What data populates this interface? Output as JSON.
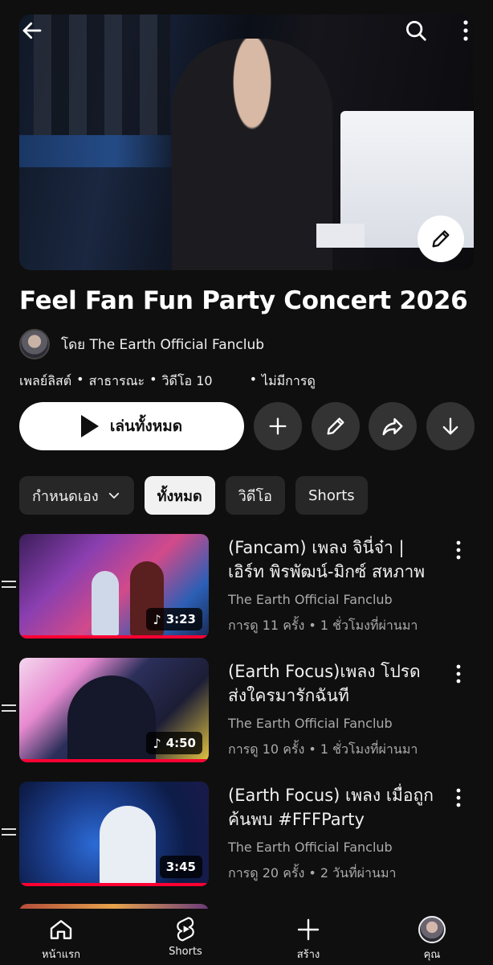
{
  "playlist": {
    "title": "Feel Fan Fun Party Concert 2026",
    "owner": "โดย The Earth Official Fanclub",
    "meta": {
      "type": "เพลย์ลิสต์",
      "visibility": "สาธารณะ",
      "video_count": "วิดีโอ 10",
      "views": "ไม่มีการดู"
    }
  },
  "actions": {
    "play_all": "เล่นทั้งหมด",
    "add_icon": "plus-icon",
    "edit_icon": "pencil-icon",
    "share_icon": "share-icon",
    "download_icon": "download-icon"
  },
  "filters": {
    "sort": "กำหนดเอง",
    "chips": [
      "ทั้งหมด",
      "วิดีโอ",
      "Shorts"
    ]
  },
  "videos": [
    {
      "title": "(Fancam) เพลง จินี่จ๋า | เอิร์ท พิรพัฒน์-มิกซ์ สหภาพ",
      "channel": "The Earth Official Fanclub",
      "stats": "การดู 11 ครั้ง • 1 ชั่วโมงที่ผ่านมา",
      "duration": "3:23",
      "has_music_note": true
    },
    {
      "title": "(Earth Focus)เพลง โปรดส่งใครมารักฉันที",
      "channel": "The Earth Official Fanclub",
      "stats": "การดู 10 ครั้ง • 1 ชั่วโมงที่ผ่านมา",
      "duration": "4:50",
      "has_music_note": true
    },
    {
      "title": "(Earth Focus) เพลง เมื่อถูกค้นพบ #FFFParty",
      "channel": "The Earth Official Fanclub",
      "stats": "การดู 20 ครั้ง • 2 วันที่ผ่านมา",
      "duration": "3:45",
      "has_music_note": false
    }
  ],
  "nav": {
    "home": "หน้าแรก",
    "shorts": "Shorts",
    "create": "สร้าง",
    "you": "คุณ"
  },
  "colors": {
    "background": "#0f0f0f",
    "progress_red": "#ff0033",
    "chip_bg": "#272727",
    "secondary_text": "#aaaaaa"
  }
}
